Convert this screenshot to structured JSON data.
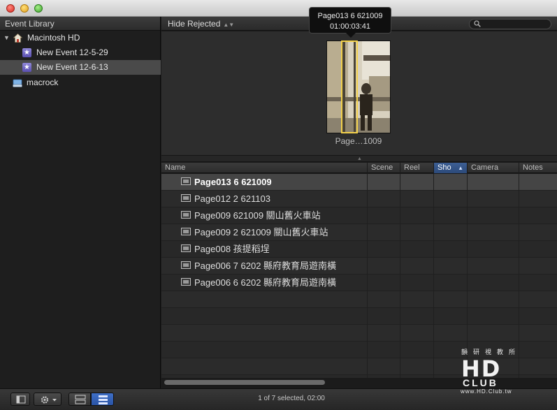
{
  "window": {
    "controls": [
      "close",
      "minimize",
      "zoom"
    ]
  },
  "sidebar": {
    "header": "Event Library",
    "items": [
      {
        "label": "Macintosh HD",
        "kind": "drive",
        "expanded": true
      },
      {
        "label": "New Event 12-5-29",
        "kind": "event"
      },
      {
        "label": "New Event 12-6-13",
        "kind": "event",
        "selected": true
      },
      {
        "label": "macrock",
        "kind": "drive"
      }
    ]
  },
  "toolbar": {
    "filter_label": "Hide Rejected",
    "search_placeholder": ""
  },
  "filmstrip": {
    "tooltip_name": "Page013 6 621009",
    "tooltip_time": "01:00:03:41",
    "thumb_label": "Page…1009"
  },
  "list": {
    "columns": [
      "Name",
      "Scene",
      "Reel",
      "Sho",
      "Camera",
      "Notes"
    ],
    "sorted_column": "Sho",
    "rows": [
      "Page013 6 621009",
      "Page012 2 621103",
      "Page009 621009 關山舊火車站",
      "Page009 2 621009 關山舊火車站",
      "Page008 孩提稻埕",
      "Page006 7 6202 縣府教育局遊南橫",
      "Page006 6 6202 縣府教育局遊南橫"
    ],
    "selected_row": 0
  },
  "status": {
    "text": "1 of 7 selected, 02:00"
  },
  "watermark": {
    "top": "韻研視教所",
    "hd": "HD",
    "club": "CLUB",
    "url": "www.HD.Club.tw"
  },
  "colors": {
    "accent": "#2c4a7a",
    "playhead": "#f2d04a",
    "event_icon": "#6b62c4"
  }
}
